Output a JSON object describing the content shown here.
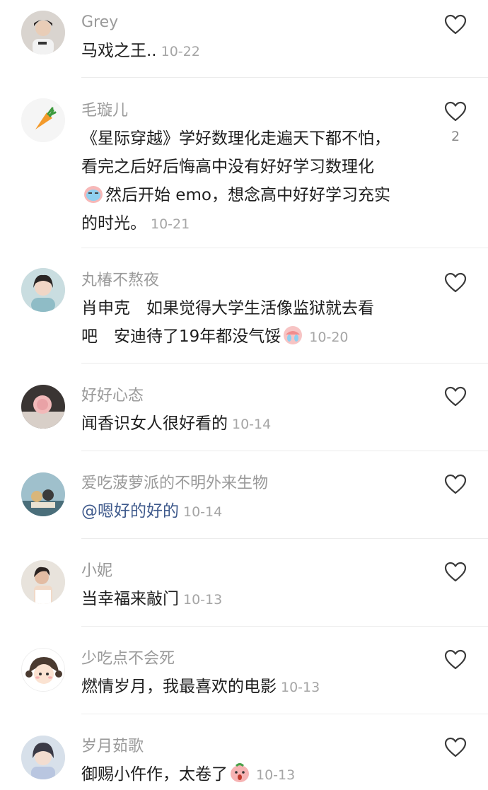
{
  "comments": [
    {
      "user": "Grey",
      "lines": [
        "马戏之王.."
      ],
      "date": "10-22",
      "avatar": "person-avatar",
      "likes": ""
    },
    {
      "user": "毛璇儿",
      "lines": [
        "《星际穿越》学好数理化走遍天下都不怕，",
        "看完之后好后悔高中没有好好学习数理化",
        "然后开始 emo，想念高中好好学习充实",
        "的时光。"
      ],
      "date": "10-21",
      "avatar": "carrot-avatar",
      "likes": "2",
      "emoji": "crying-face-emoji"
    },
    {
      "user": "丸椿不熬夜",
      "lines": [
        "肖申克　如果觉得大学生活像监狱就去看",
        "吧　安迪待了19年都没气馁"
      ],
      "date": "10-20",
      "avatar": "person-avatar",
      "likes": "",
      "emoji": "crying-face-emoji"
    },
    {
      "user": "好好心态",
      "lines": [
        "闻香识女人很好看的"
      ],
      "date": "10-14",
      "avatar": "object-avatar",
      "likes": ""
    },
    {
      "user": "爱吃菠萝派的不明外来生物",
      "lines": [
        "@嗯好的好的"
      ],
      "date": "10-14",
      "avatar": "cats-avatar",
      "likes": ""
    },
    {
      "user": "小妮",
      "lines": [
        "当幸福来敲门"
      ],
      "date": "10-13",
      "avatar": "person-avatar",
      "likes": ""
    },
    {
      "user": "少吃点不会死",
      "lines": [
        "燃情岁月，我最喜欢的电影"
      ],
      "date": "10-13",
      "avatar": "cartoon-girl-avatar",
      "likes": ""
    },
    {
      "user": "岁月茹歌",
      "lines": [
        "御赐小仵作，太卷了"
      ],
      "date": "10-13",
      "avatar": "person-avatar",
      "likes": "",
      "emoji": "surprised-face-emoji"
    }
  ],
  "colors": {
    "username": "#9a9a9a",
    "text": "#1e1e1e",
    "date": "#a5a5a5",
    "mention": "#3f5a8c",
    "divider": "#ececec"
  },
  "icons": {
    "like": "heart-outline-icon"
  }
}
